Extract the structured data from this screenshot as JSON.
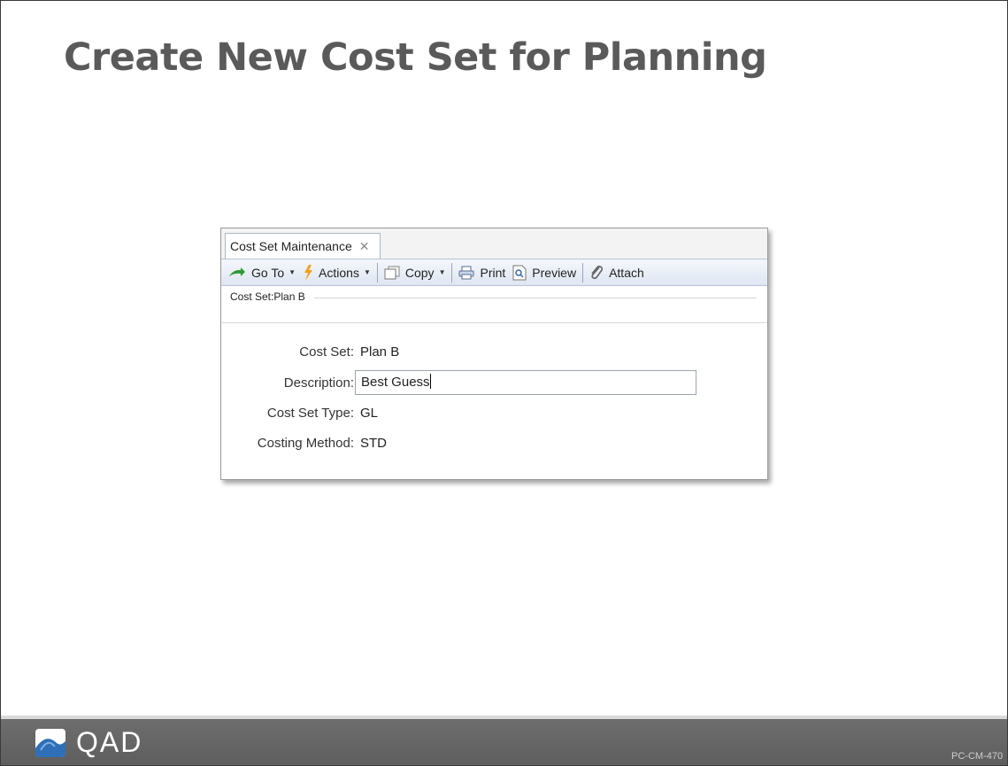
{
  "slide": {
    "title": "Create New Cost Set for Planning",
    "code": "PC-CM-470"
  },
  "window": {
    "tab_label": "Cost Set Maintenance",
    "tab_close_icon": "close-icon",
    "toolbar": {
      "goto_label": "Go To",
      "actions_label": "Actions",
      "copy_label": "Copy",
      "print_label": "Print",
      "preview_label": "Preview",
      "attach_label": "Attach"
    },
    "breadcrumb": "Cost Set:Plan B",
    "form": {
      "cost_set_label": "Cost Set:",
      "cost_set_value": "Plan B",
      "description_label": "Description:",
      "description_value": "Best Guess",
      "cost_set_type_label": "Cost Set Type:",
      "cost_set_type_value": "GL",
      "costing_method_label": "Costing Method:",
      "costing_method_value": "STD"
    }
  },
  "footer": {
    "logo_text": "QAD"
  },
  "colors": {
    "title": "#5a5a5a",
    "footer": "#666666",
    "toolbar": "#dfe6f2"
  }
}
